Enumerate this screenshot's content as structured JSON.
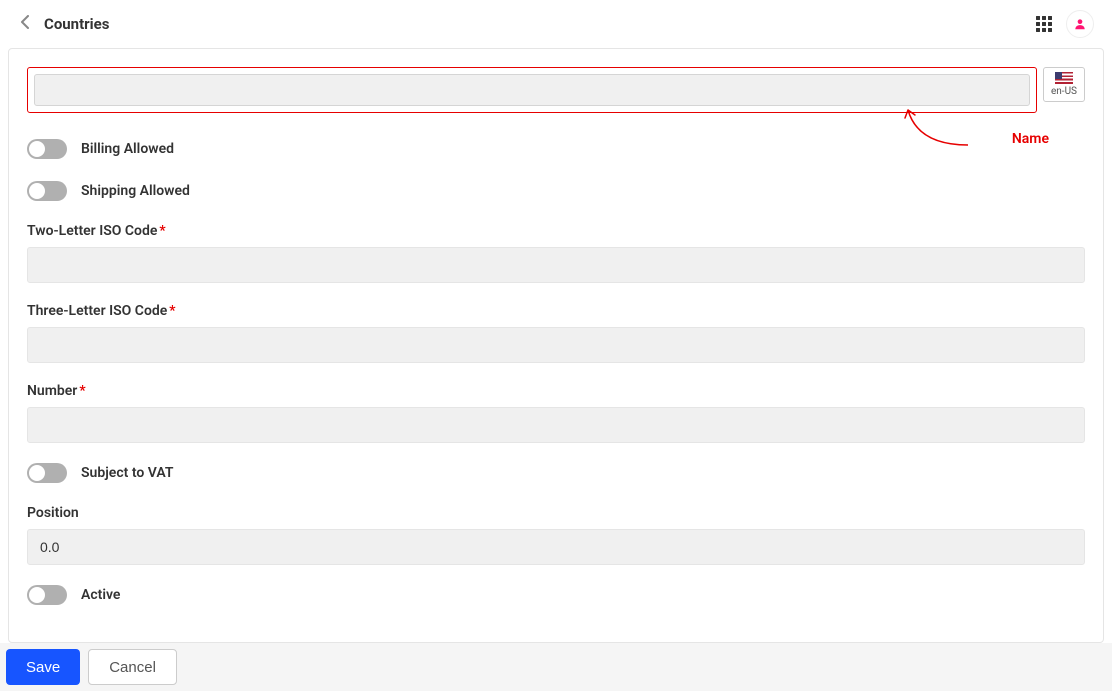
{
  "header": {
    "title": "Countries",
    "locale_label": "en-US"
  },
  "form": {
    "name": {
      "value": ""
    },
    "billing_allowed": {
      "label": "Billing Allowed",
      "value": false
    },
    "shipping_allowed": {
      "label": "Shipping Allowed",
      "value": false
    },
    "two_letter_iso": {
      "label": "Two-Letter ISO Code",
      "required_marker": "*",
      "value": ""
    },
    "three_letter_iso": {
      "label": "Three-Letter ISO Code",
      "required_marker": "*",
      "value": ""
    },
    "number": {
      "label": "Number",
      "required_marker": "*",
      "value": ""
    },
    "subject_to_vat": {
      "label": "Subject to VAT",
      "value": false
    },
    "position": {
      "label": "Position",
      "value": "0.0"
    },
    "active": {
      "label": "Active",
      "value": false
    }
  },
  "callout": {
    "label": "Name"
  },
  "actions": {
    "save": "Save",
    "cancel": "Cancel"
  }
}
